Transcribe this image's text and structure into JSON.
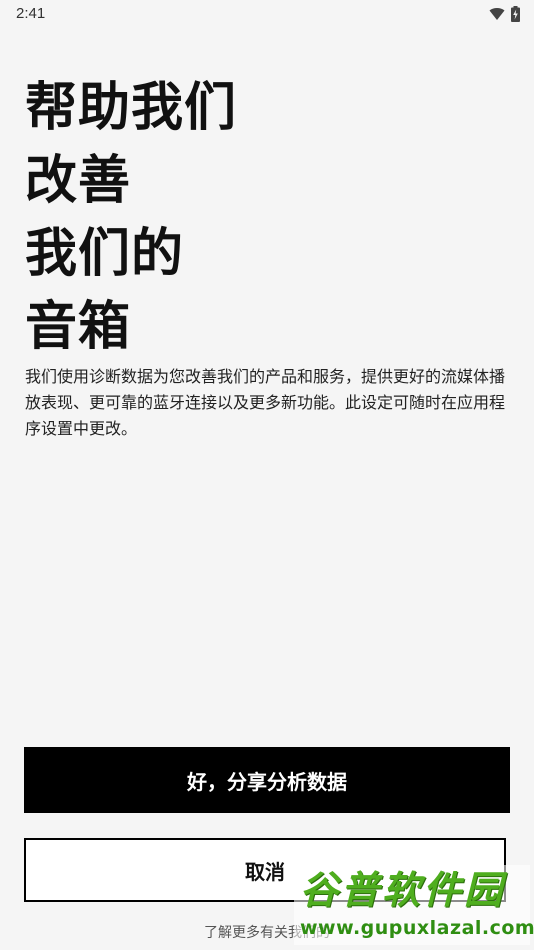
{
  "status_bar": {
    "time": "2:41",
    "icons": [
      "wifi-icon",
      "battery-charging-icon"
    ]
  },
  "headline": {
    "lines": [
      "帮助我们",
      "改善",
      "我们的",
      "音箱"
    ]
  },
  "description": "我们使用诊断数据为您改善我们的产品和服务，提供更好的流媒体播放表现、更可靠的蓝牙连接以及更多新功能。此设定可随时在应用程序设置中更改。",
  "buttons": {
    "primary_label": "好，分享分析数据",
    "secondary_label": "取消"
  },
  "learn_more": "了解更多有关我们的",
  "watermark": {
    "logo": "谷普软件园",
    "url": "www.gupuxlazal.com"
  },
  "colors": {
    "background": "#f5f5f5",
    "primary_button": "#000000",
    "watermark_green": "#4fae1f"
  }
}
